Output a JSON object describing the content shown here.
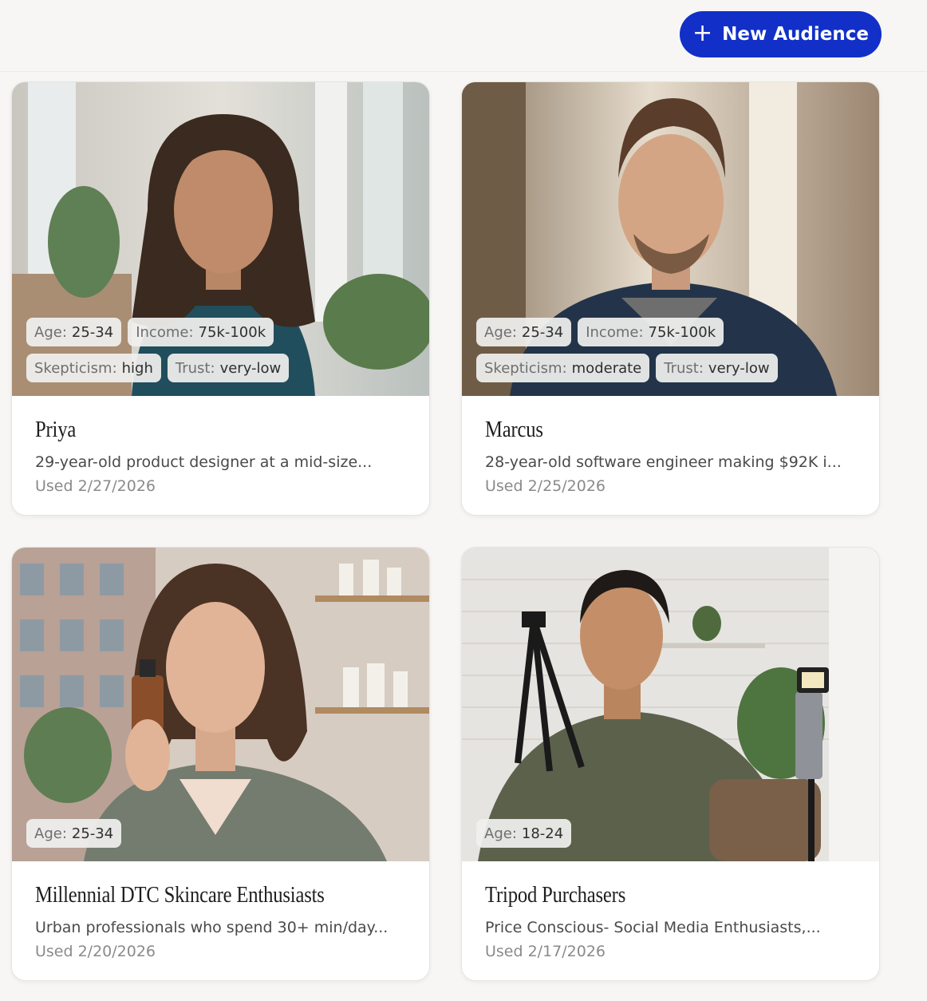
{
  "header": {
    "new_audience_label": "New Audience",
    "plus_icon": "+"
  },
  "audiences": [
    {
      "name": "Priya",
      "description": "29-year-old product designer at a mid-size...",
      "used": "Used 2/27/2026",
      "tags": [
        {
          "key": "Age:",
          "value": "25-34"
        },
        {
          "key": "Income:",
          "value": "75k-100k"
        },
        {
          "key": "Skepticism:",
          "value": "high"
        },
        {
          "key": "Trust:",
          "value": "very-low"
        }
      ]
    },
    {
      "name": "Marcus",
      "description": "28-year-old software engineer making $92K i...",
      "used": "Used 2/25/2026",
      "tags": [
        {
          "key": "Age:",
          "value": "25-34"
        },
        {
          "key": "Income:",
          "value": "75k-100k"
        },
        {
          "key": "Skepticism:",
          "value": "moderate"
        },
        {
          "key": "Trust:",
          "value": "very-low"
        }
      ]
    },
    {
      "name": "Millennial DTC Skincare Enthusiasts",
      "description": "Urban professionals who spend 30+ min/day...",
      "used": "Used 2/20/2026",
      "tags": [
        {
          "key": "Age:",
          "value": "25-34"
        }
      ]
    },
    {
      "name": "Tripod Purchasers",
      "description": "Price Conscious- Social Media Enthusiasts,...",
      "used": "Used 2/17/2026",
      "tags": [
        {
          "key": "Age:",
          "value": "18-24"
        }
      ]
    }
  ]
}
